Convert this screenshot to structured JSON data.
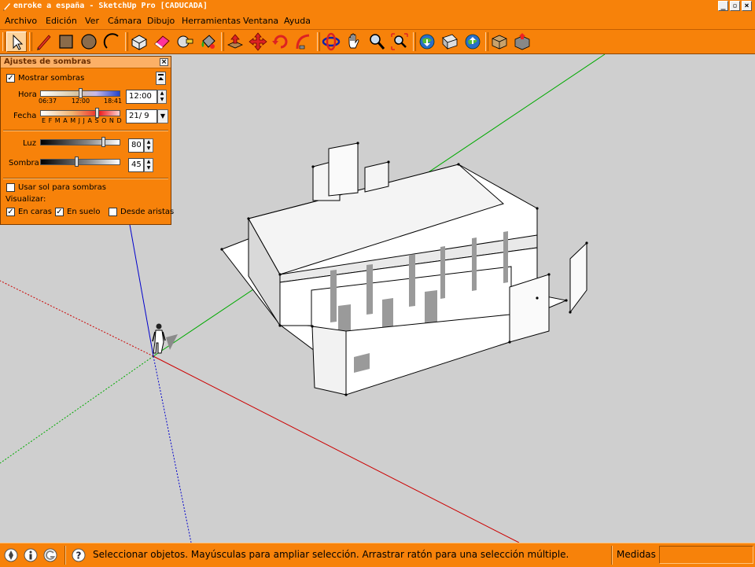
{
  "window": {
    "title": "enroke a españa - SketchUp Pro [CADUCADA]",
    "controls": [
      "minimize",
      "restore",
      "close"
    ]
  },
  "menu": [
    "Archivo",
    "Edición",
    "Ver",
    "Cámara",
    "Dibujo",
    "Herramientas",
    "Ventana",
    "Ayuda"
  ],
  "toolbar": [
    {
      "name": "select-tool-icon",
      "active": true
    },
    {
      "name": "line-tool-icon"
    },
    {
      "name": "rectangle-tool-icon"
    },
    {
      "name": "circle-tool-icon"
    },
    {
      "name": "arc-tool-icon"
    },
    {
      "name": "make-component-icon"
    },
    {
      "name": "eraser-icon"
    },
    {
      "name": "tape-measure-icon"
    },
    {
      "name": "paint-bucket-icon"
    },
    {
      "name": "push-pull-icon"
    },
    {
      "name": "move-icon"
    },
    {
      "name": "rotate-icon"
    },
    {
      "name": "follow-me-icon"
    },
    {
      "name": "orbit-icon"
    },
    {
      "name": "pan-icon"
    },
    {
      "name": "zoom-icon"
    },
    {
      "name": "zoom-extents-icon"
    },
    {
      "name": "get-models-icon"
    },
    {
      "name": "share-model-icon"
    },
    {
      "name": "share-component-icon"
    },
    {
      "name": "warehouse-component-icon"
    },
    {
      "name": "warehouse-model-icon"
    }
  ],
  "shadow_panel": {
    "title": "Ajustes de sombras",
    "show_shadows_label": "Mostrar sombras",
    "show_shadows": true,
    "time_label": "Hora",
    "time_start": "06:37",
    "time_mid": "12:00",
    "time_end": "18:41",
    "time_value": "12:00",
    "time_fraction": 0.5,
    "date_label": "Fecha",
    "months": "E F M A M J J A S O N D",
    "date_value": "21/ 9",
    "date_fraction": 0.72,
    "light_label": "Luz",
    "light_value": "80",
    "light_fraction": 0.8,
    "shade_label": "Sombra",
    "shade_value": "45",
    "shade_fraction": 0.45,
    "use_sun_label": "Usar sol para sombras",
    "use_sun": false,
    "display_label": "Visualizar:",
    "on_faces_label": "En caras",
    "on_faces": true,
    "on_ground_label": "En suelo",
    "on_ground": true,
    "from_edges_label": "Desde aristas",
    "from_edges": false
  },
  "status": {
    "message": "Seleccionar objetos. Mayúsculas para ampliar selección. Arrastrar ratón para una selección múltiple.",
    "measure_label": "Medidas",
    "measure_value": ""
  },
  "colors": {
    "accent": "#f7820a",
    "viewport": "#cfcfcf",
    "axis_red": "#cc0000",
    "axis_green": "#00aa00",
    "axis_blue": "#0000cc"
  }
}
